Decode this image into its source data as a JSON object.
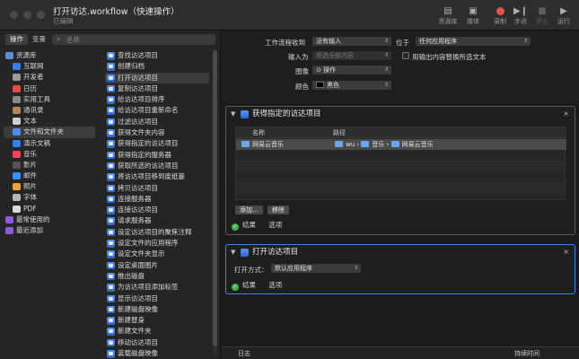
{
  "window": {
    "title": "打开访达.workflow（快速操作）",
    "subtitle": "已编辑"
  },
  "toolbar": {
    "library_label": "资源库",
    "media_label": "媒体",
    "record_label": "录制",
    "step_label": "步进",
    "stop_label": "停止",
    "run_label": "运行",
    "record_color": "#e5534b"
  },
  "leftpane": {
    "tab_actions": "操作",
    "tab_variables": "变量",
    "search_placeholder": "名称",
    "library": [
      {
        "label": "资源库",
        "icon": "library-folder-icon",
        "color": "#5a8fd6"
      },
      {
        "label": "互联网",
        "icon": "globe-icon",
        "color": "#3c7be0"
      },
      {
        "label": "开发者",
        "icon": "hammer-icon",
        "color": "#9a9a9a"
      },
      {
        "label": "日历",
        "icon": "calendar-icon",
        "color": "#e64b4b"
      },
      {
        "label": "实用工具",
        "icon": "tools-icon",
        "color": "#8a8a8a"
      },
      {
        "label": "通讯录",
        "icon": "contacts-icon",
        "color": "#b08a5a"
      },
      {
        "label": "文本",
        "icon": "text-icon",
        "color": "#cfcfcf"
      },
      {
        "label": "文件和文件夹",
        "icon": "finder-icon",
        "color": "#4f8ee8"
      },
      {
        "label": "演示文稿",
        "icon": "keynote-icon",
        "color": "#3a7fe5"
      },
      {
        "label": "音乐",
        "icon": "music-icon",
        "color": "#f2405d"
      },
      {
        "label": "影片",
        "icon": "movie-icon",
        "color": "#555"
      },
      {
        "label": "邮件",
        "icon": "mail-icon",
        "color": "#3d8fef"
      },
      {
        "label": "照片",
        "icon": "photos-icon",
        "color": "#e9a33a"
      },
      {
        "label": "字体",
        "icon": "font-icon",
        "color": "#b5b5b5"
      },
      {
        "label": "PDF",
        "icon": "pdf-icon",
        "color": "#d9d9d9"
      },
      {
        "label": "最常使用的",
        "icon": "purple-folder-icon",
        "color": "#8e5ad6"
      },
      {
        "label": "最近添加",
        "icon": "purple-folder-icon",
        "color": "#8e5ad6"
      }
    ],
    "actions": [
      "查找访达项目",
      "创建归档",
      "打开访达项目",
      "复制访达项目",
      "给访达项目排序",
      "给访达项目重新命名",
      "过滤访达项目",
      "获得文件夹内容",
      "获得指定的访达项目",
      "获得指定的服务器",
      "获取所选的访达项目",
      "将访达项目移到废纸篓",
      "拷贝访达项目",
      "连接服务器",
      "连接访达项目",
      "请求服务器",
      "设定访达项目的聚焦注释",
      "设定文件的应用程序",
      "设定文件夹显示",
      "设定桌面图片",
      "推出磁盘",
      "为访达项目添加标签",
      "显示访达项目",
      "新建磁盘映像",
      "新建替身",
      "新建文件夹",
      "移动访达项目",
      "装载磁盘映像"
    ]
  },
  "variables": {
    "workflow_receives_label": "工作流程收到",
    "workflow_receives_value": "没有输入",
    "location_label": "位于",
    "location_value": "任何应用程序",
    "input_label": "输入为",
    "input_value": "用选全部内容",
    "replace_label": "用输出内容替换所选文本",
    "image_label": "图像",
    "image_value": "⊙ 操作",
    "color_label": "颜色",
    "color_value": "黑色"
  },
  "card1": {
    "title": "获得指定的访达项目",
    "col_name": "名称",
    "col_path": "路径",
    "row_name": "网易云音乐",
    "path_seg1": "wu",
    "path_seg2": "音乐",
    "path_seg3": "网易云音乐",
    "add_button": "添加...",
    "remove_button": "移除",
    "results": "结果",
    "options": "选项"
  },
  "card2": {
    "title": "打开访达项目",
    "open_with_label": "打开方式：",
    "open_with_value": "默认应用程序",
    "results": "结果",
    "options": "选项"
  },
  "log": {
    "col_log": "日志",
    "col_duration": "持续时间"
  }
}
